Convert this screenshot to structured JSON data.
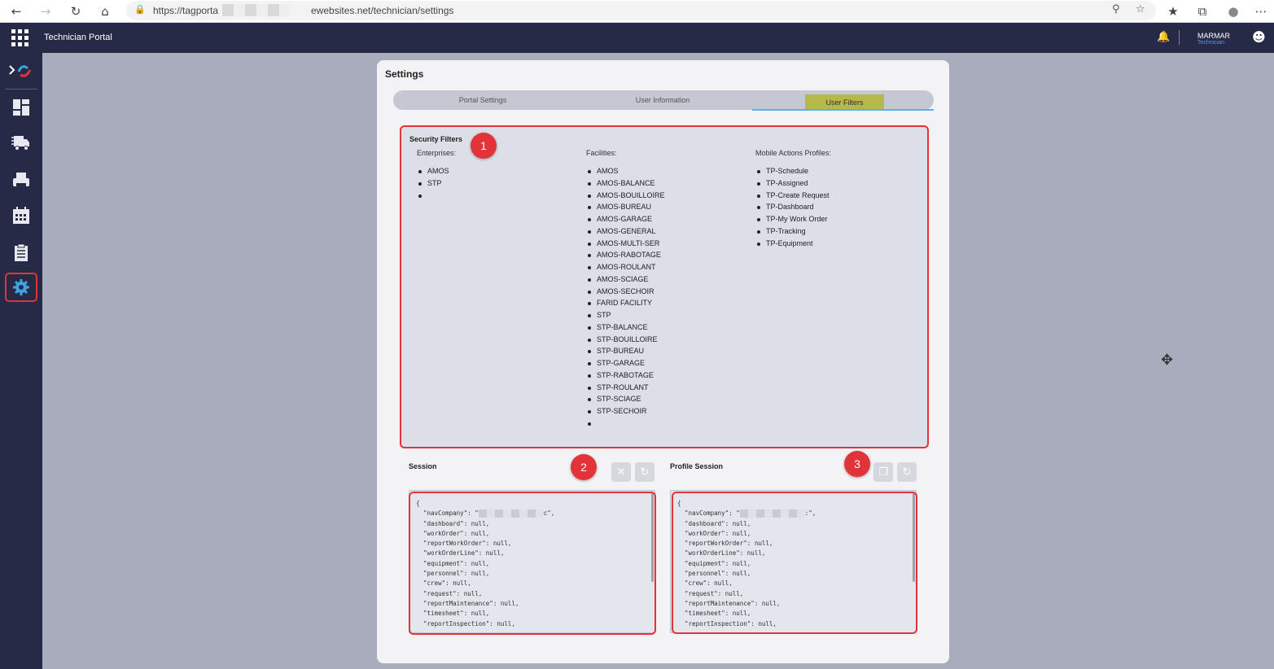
{
  "browser": {
    "url_prefix": "https://tagporta",
    "url_suffix": "ewebsites.net/technician/settings"
  },
  "app": {
    "title": "Technician Portal",
    "user_name": "MARMAR",
    "user_role": "Technician"
  },
  "sidebar": {
    "items": [
      {
        "name": "expand-logo",
        "icon": "chevron-logo-icon"
      },
      {
        "name": "dashboard",
        "icon": "dashboard-icon"
      },
      {
        "name": "trucks",
        "icon": "truck-icon"
      },
      {
        "name": "printer",
        "icon": "printer-icon"
      },
      {
        "name": "calendar",
        "icon": "calendar-icon"
      },
      {
        "name": "clipboard",
        "icon": "clipboard-icon"
      },
      {
        "name": "settings",
        "icon": "gear-icon",
        "active": true
      }
    ]
  },
  "settings": {
    "title": "Settings",
    "tabs": [
      {
        "label": "Portal Settings"
      },
      {
        "label": "User Information"
      },
      {
        "label": "User Filters",
        "active": true
      }
    ],
    "security": {
      "title": "Security Filters",
      "enterprises_label": "Enterprises:",
      "enterprises": [
        "AMOS",
        "STP",
        ""
      ],
      "facilities_label": "Facilities:",
      "facilities": [
        "AMOS",
        "AMOS-BALANCE",
        "AMOS-BOUILLOIRE",
        "AMOS-BUREAU",
        "AMOS-GARAGE",
        "AMOS-GENERAL",
        "AMOS-MULTI-SER",
        "AMOS-RABOTAGE",
        "AMOS-ROULANT",
        "AMOS-SCIAGE",
        "AMOS-SECHOIR",
        "FARID FACILITY",
        "STP",
        "STP-BALANCE",
        "STP-BOUILLOIRE",
        "STP-BUREAU",
        "STP-GARAGE",
        "STP-RABOTAGE",
        "STP-ROULANT",
        "STP-SCIAGE",
        "STP-SECHOIR",
        ""
      ],
      "mobile_label": "Mobile Actions Profiles:",
      "mobile_profiles": [
        "TP-Schedule",
        "TP-Assigned",
        "TP-Create Request",
        "TP-Dashboard",
        "TP-My Work Order",
        "TP-Tracking",
        "TP-Equipment"
      ]
    },
    "session": {
      "label": "Session",
      "lines_before": [
        "{"
      ],
      "company_key": "\"navCompany\": \"",
      "company_end": "c\",",
      "lines_after": [
        "\"dashboard\": null,",
        "\"workOrder\": null,",
        "\"reportWorkOrder\": null,",
        "\"workOrderLine\": null,",
        "\"equipment\": null,",
        "\"personnel\": null,",
        "\"crew\": null,",
        "\"request\": null,",
        "\"reportMaintenance\": null,",
        "\"timesheet\": null,",
        "\"reportInspection\": null,"
      ]
    },
    "profile_session": {
      "label": "Profile Session",
      "company_end": ":\","
    },
    "annotations": [
      "1",
      "2",
      "3"
    ]
  },
  "colors": {
    "nav_bg": "#262a47",
    "accent_red": "#e2333b",
    "active_tab": "#b5b84a",
    "role_blue": "#3ea4e0"
  }
}
